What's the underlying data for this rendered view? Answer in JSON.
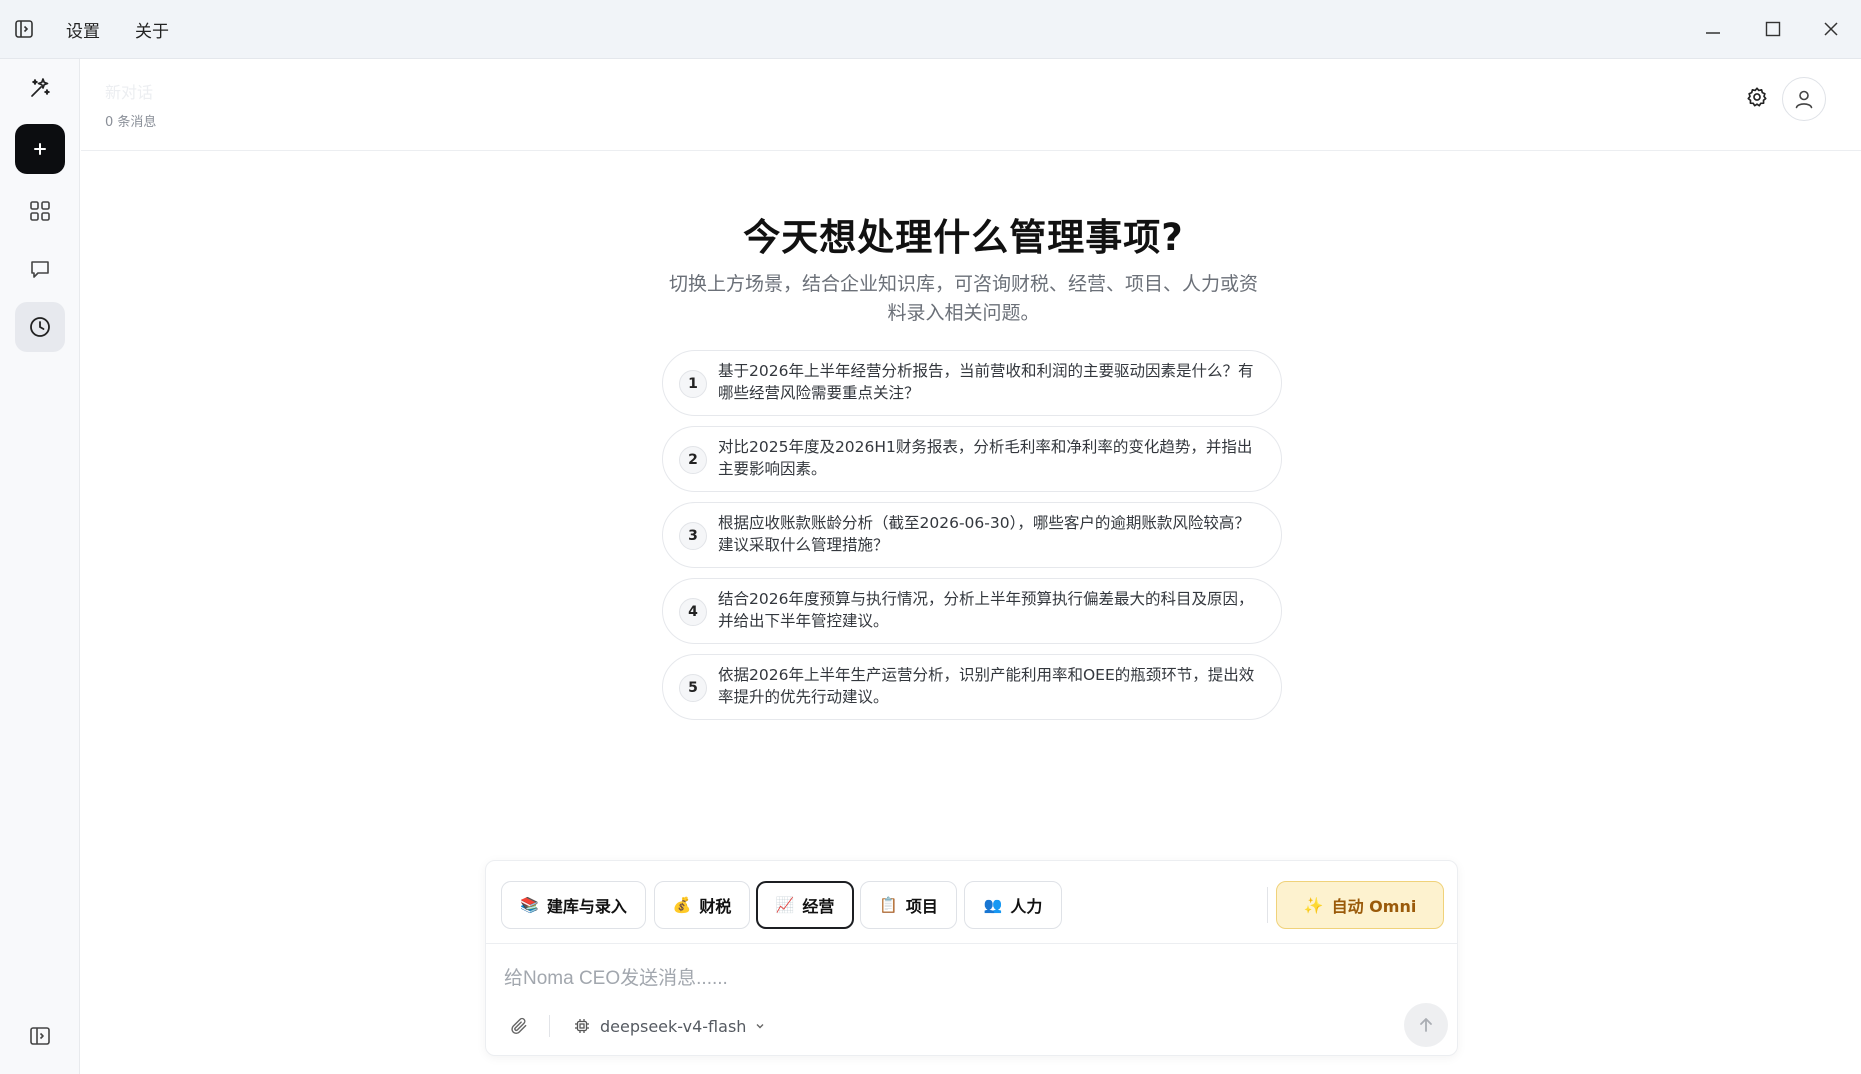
{
  "titlebar": {
    "menu": [
      "设置",
      "关于"
    ]
  },
  "header": {
    "conversation_title": "新对话",
    "message_count": "0 条消息"
  },
  "hero": {
    "title": "今天想处理什么管理事项?",
    "subtitle": "切换上方场景，结合企业知识库，可咨询财税、经营、项目、人力或资料录入相关问题。"
  },
  "suggestions": [
    {
      "num": "1",
      "text": "基于2026年上半年经营分析报告，当前营收和利润的主要驱动因素是什么？有哪些经营风险需要重点关注？"
    },
    {
      "num": "2",
      "text": "对比2025年度及2026H1财务报表，分析毛利率和净利率的变化趋势，并指出主要影响因素。"
    },
    {
      "num": "3",
      "text": "根据应收账款账龄分析（截至2026-06-30），哪些客户的逾期账款风险较高？建议采取什么管理措施？"
    },
    {
      "num": "4",
      "text": "结合2026年度预算与执行情况，分析上半年预算执行偏差最大的科目及原因，并给出下半年管控建议。"
    },
    {
      "num": "5",
      "text": "依据2026年上半年生产运营分析，识别产能利用率和OEE的瓶颈环节，提出效率提升的优先行动建议。"
    }
  ],
  "composer": {
    "scenes": [
      {
        "emoji": "📚",
        "label": "建库与录入"
      },
      {
        "emoji": "💰",
        "label": "财税"
      },
      {
        "emoji": "📈",
        "label": "经营"
      },
      {
        "emoji": "📋",
        "label": "项目"
      },
      {
        "emoji": "👥",
        "label": "人力"
      }
    ],
    "active_scene": "经营",
    "omni": {
      "emoji": "✨",
      "label": "自动 Omni"
    },
    "input_placeholder": "给Noma CEO发送消息......",
    "input_value": "",
    "model": "deepseek-v4-flash"
  },
  "icons": {
    "sidebar_toggle": "sidebar-toggle-icon",
    "rail": [
      "sparkles-icon",
      "plus-icon",
      "grid-icon",
      "chat-bubble-icon",
      "clock-history-icon",
      "panel-expand-icon"
    ],
    "header": [
      "gear-icon",
      "user-icon"
    ],
    "composer": [
      "paperclip-icon",
      "cpu-chip-icon",
      "chevron-down-icon",
      "arrow-up-icon"
    ]
  },
  "colors": {
    "new_button_bg": "#0c0d10",
    "omni_bg": "#fdf2cf",
    "omni_text": "#9a5a0a",
    "titlebar_bg": "#f1f4f8"
  }
}
